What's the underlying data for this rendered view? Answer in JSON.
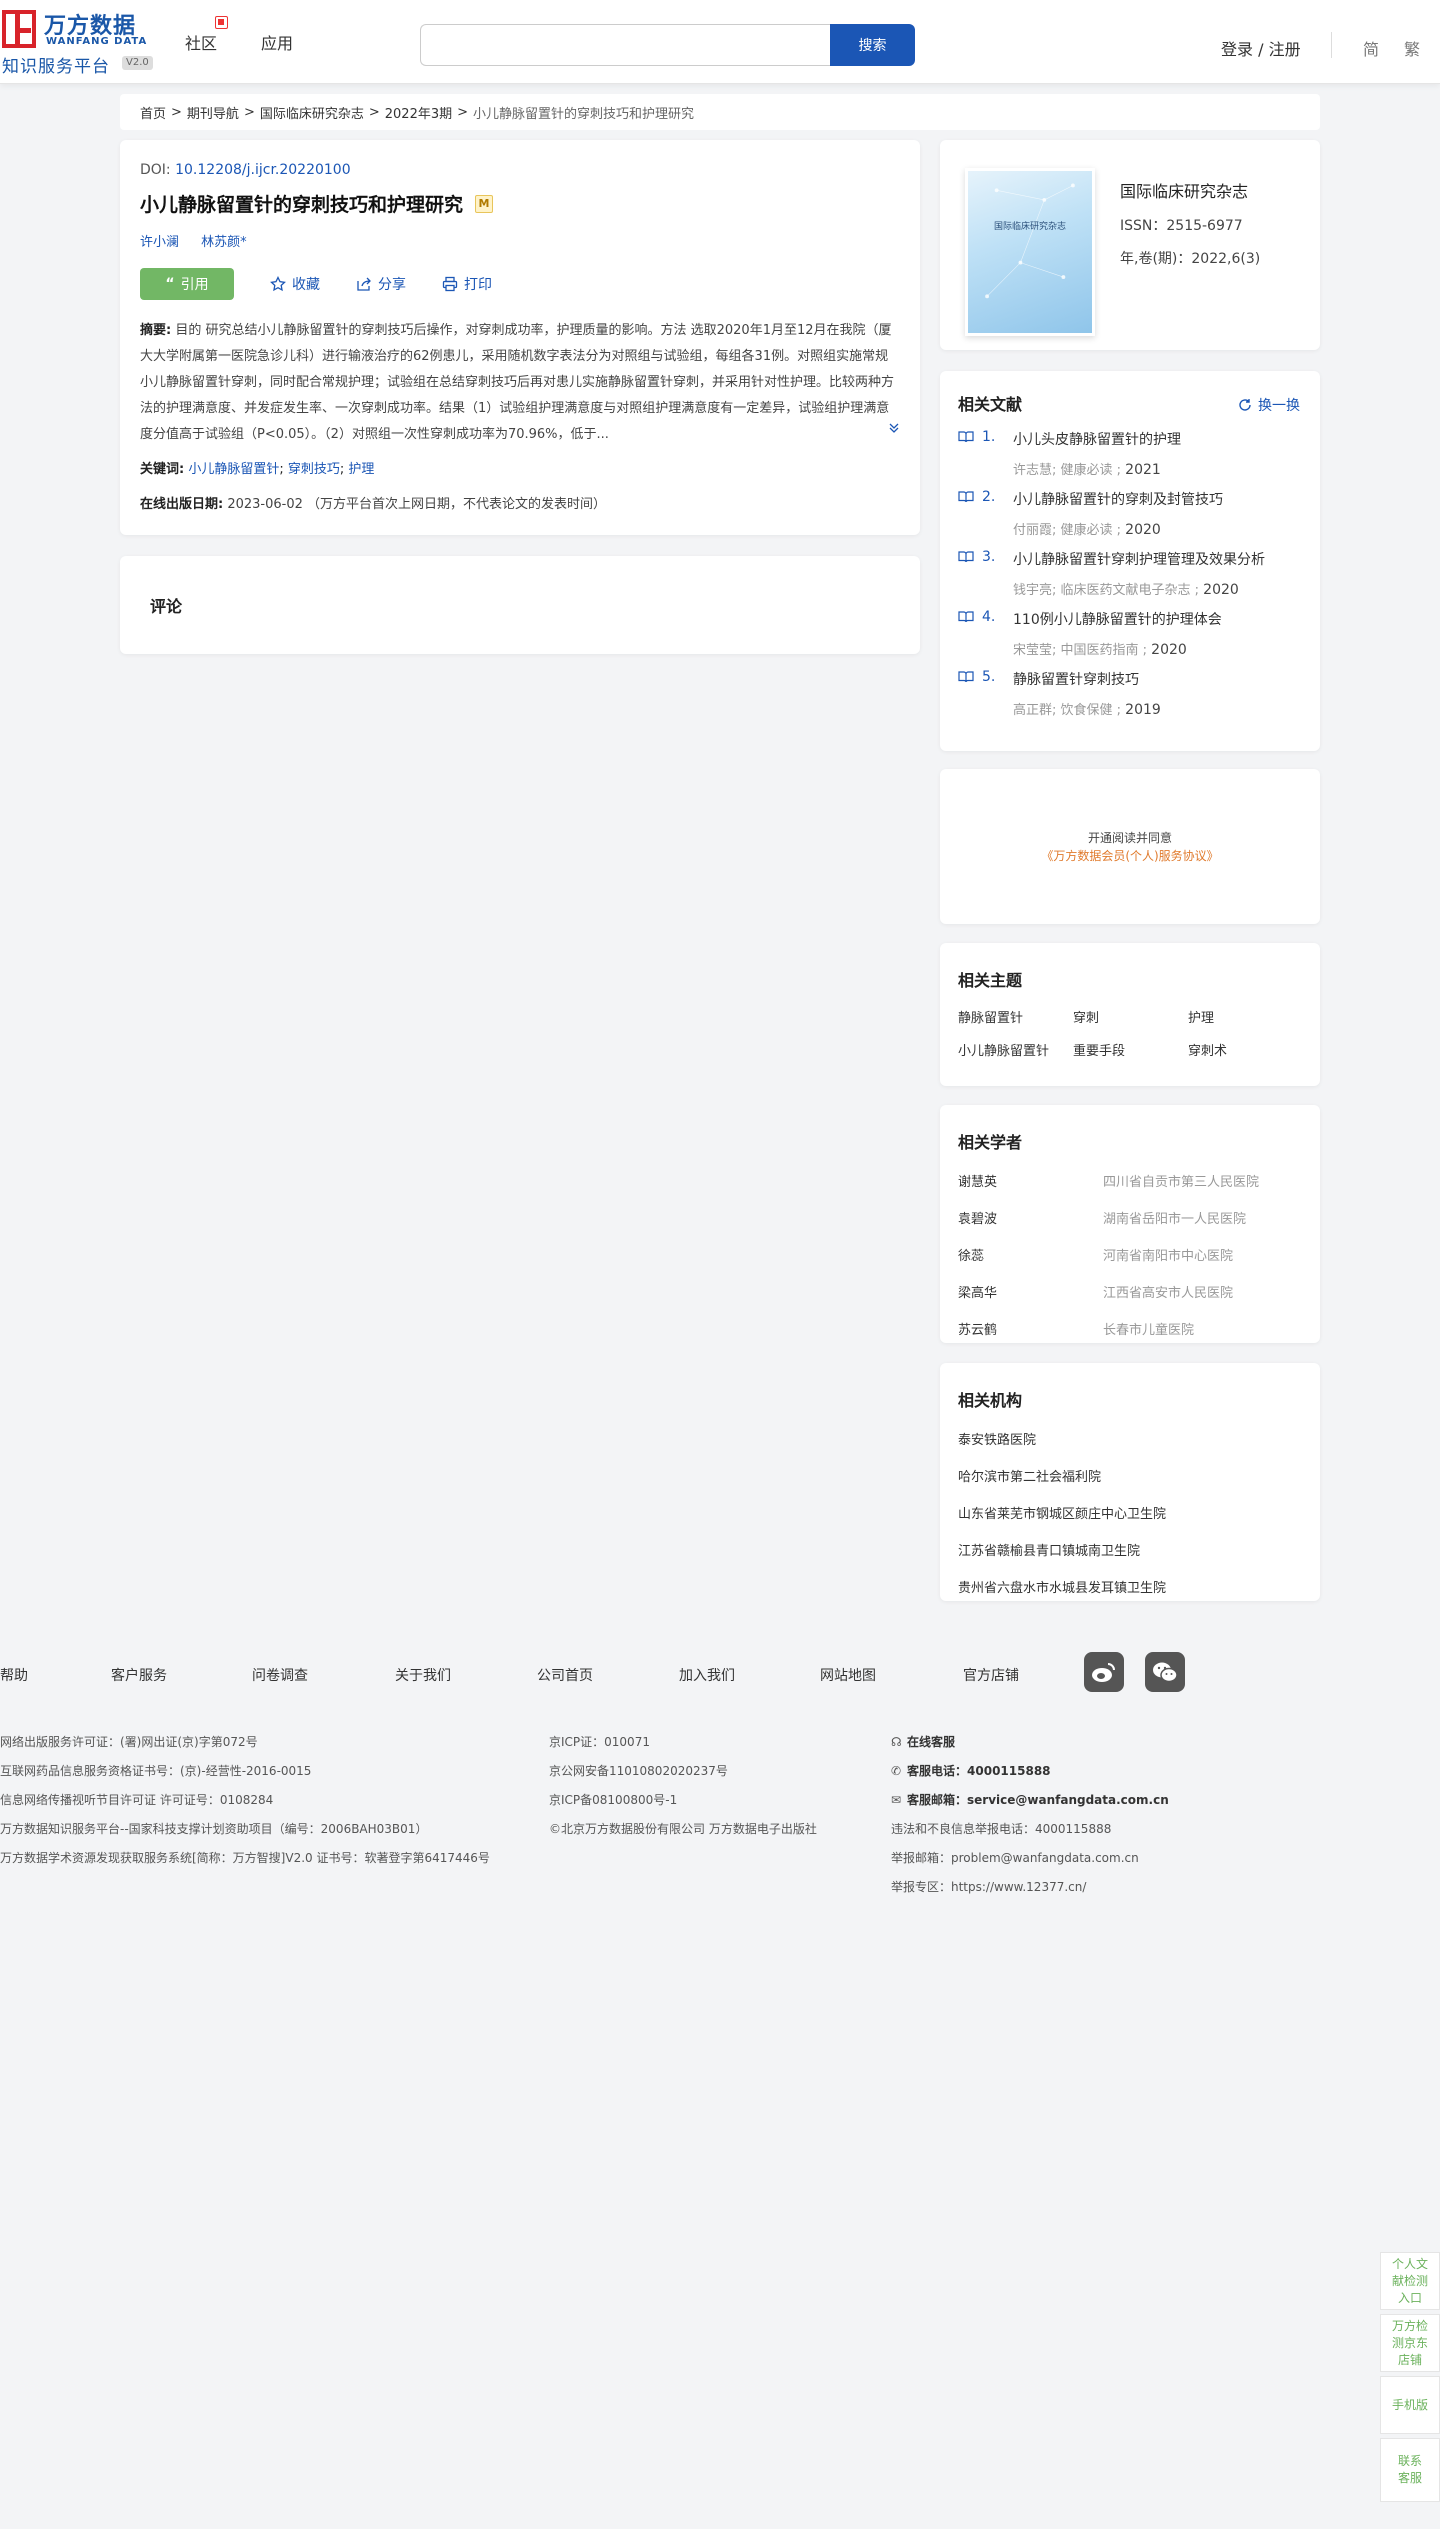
{
  "header": {
    "logo_cn": "万方数据",
    "logo_en": "WANFANG DATA",
    "logo_sub": "知识服务平台",
    "logo_version": "V2.0",
    "nav": [
      "社区",
      "应用"
    ],
    "search_placeholder": "",
    "search_button": "搜索",
    "login": "登录 / 注册",
    "lang_simplified": "简",
    "lang_traditional": "繁"
  },
  "breadcrumb": [
    "首页",
    "期刊导航",
    "国际临床研究杂志",
    "2022年3期",
    "小儿静脉留置针的穿刺技巧和护理研究"
  ],
  "article": {
    "doi_label": "DOI: ",
    "doi": "10.12208/j.ijcr.20220100",
    "title": "小儿静脉留置针的穿刺技巧和护理研究",
    "badge": "M",
    "authors": [
      "许小澜",
      "林苏颜*"
    ],
    "actions": {
      "cite": "引用",
      "favorite": "收藏",
      "share": "分享",
      "print": "打印"
    },
    "abstract_label": "摘要:",
    "abstract": "目的 研究总结小儿静脉留置针的穿刺技巧后操作，对穿刺成功率，护理质量的影响。方法 选取2020年1月至12月在我院（厦大大学附属第一医院急诊儿科）进行输液治疗的62例患儿，采用随机数字表法分为对照组与试验组，每组各31例。对照组实施常规小儿静脉留置针穿刺，同时配合常规护理；试验组在总结穿刺技巧后再对患儿实施静脉留置针穿刺，并采用针对性护理。比较两种方法的护理满意度、并发症发生率、一次穿刺成功率。结果（1）试验组护理满意度与对照组护理满意度有一定差异，试验组护理满意度分值高于试验组（P<0.05）。（2）对照组一次性穿刺成功率为70.96%，低于...",
    "keywords_label": "关键词:",
    "keywords": [
      "小儿静脉留置针",
      "穿刺技巧",
      "护理"
    ],
    "pubdate_label": "在线出版日期:",
    "pubdate": "2023-06-02",
    "pubdate_note": "（万方平台首次上网日期，不代表论文的发表时间）"
  },
  "comment": {
    "title": "评论"
  },
  "journal": {
    "cover_title": "国际临床研究杂志",
    "name": "国际临床研究杂志",
    "issn": "ISSN：2515-6977",
    "volume": "年,卷(期)：2022,6(3)"
  },
  "related": {
    "title": "相关文献",
    "swap": "换一换",
    "items": [
      {
        "num": "1.",
        "title": "小儿头皮静脉留置针的护理",
        "meta": "许志慧; 健康必读 ; ",
        "year": "2021"
      },
      {
        "num": "2.",
        "title": "小儿静脉留置针的穿刺及封管技巧",
        "meta": "付丽霞; 健康必读 ; ",
        "year": "2020"
      },
      {
        "num": "3.",
        "title": "小儿静脉留置针穿刺护理管理及效果分析",
        "meta": "钱宇亮; 临床医药文献电子杂志 ; ",
        "year": "2020"
      },
      {
        "num": "4.",
        "title": "110例小儿静脉留置针的护理体会",
        "meta": "宋莹莹; 中国医药指南 ; ",
        "year": "2020"
      },
      {
        "num": "5.",
        "title": "静脉留置针穿刺技巧",
        "meta": "高正群; 饮食保健 ; ",
        "year": "2019"
      }
    ]
  },
  "open_read": {
    "line1": "开通阅读并同意",
    "line2": "《万方数据会员(个人)服务协议》"
  },
  "topics": {
    "title": "相关主题",
    "items": [
      "静脉留置针",
      "穿刺",
      "护理",
      "小儿静脉留置针",
      "重要手段",
      "穿刺术"
    ]
  },
  "scholars": {
    "title": "相关学者",
    "items": [
      {
        "name": "谢慧英",
        "org": "四川省自贡市第三人民医院"
      },
      {
        "name": "袁碧波",
        "org": "湖南省岳阳市一人民医院"
      },
      {
        "name": "徐蕊",
        "org": "河南省南阳市中心医院"
      },
      {
        "name": "梁高华",
        "org": "江西省高安市人民医院"
      },
      {
        "name": "苏云鹤",
        "org": "长春市儿童医院"
      }
    ]
  },
  "orgs": {
    "title": "相关机构",
    "items": [
      "泰安铁路医院",
      "哈尔滨市第二社会福利院",
      "山东省莱芜市钢城区颜庄中心卫生院",
      "江苏省赣榆县青口镇城南卫生院",
      "贵州省六盘水市水城县发耳镇卫生院"
    ]
  },
  "footer": {
    "links": [
      "帮助",
      "客户服务",
      "问卷调查",
      "关于我们",
      "公司首页",
      "加入我们",
      "网站地图",
      "官方店铺"
    ],
    "col1": [
      "网络出版服务许可证：(署)网出证(京)字第072号",
      "互联网药品信息服务资格证书号：(京)-经营性-2016-0015",
      "信息网络传播视听节目许可证 许可证号：0108284",
      "万方数据知识服务平台--国家科技支撑计划资助项目（编号：2006BAH03B01）",
      "万方数据学术资源发现获取服务系统[简称：万方智搜]V2.0 证书号：软著登字第6417446号"
    ],
    "col2": [
      "京ICP证：010071",
      "京公网安备11010802020237号",
      "京ICP备08100800号-1",
      "©北京万方数据股份有限公司 万方数据电子出版社"
    ],
    "col3": {
      "online": "在线客服",
      "phone_label": "客服电话：",
      "phone": "4000115888",
      "email_label": "客服邮箱：",
      "email": "service@wanfangdata.com.cn",
      "report_phone": "违法和不良信息举报电话：4000115888",
      "report_email": "举报邮箱：problem@wanfangdata.com.cn",
      "report_site": "举报专区：https://www.12377.cn/"
    }
  },
  "float": [
    "个人文献检测入口",
    "万方检测京东店铺",
    "手机版",
    "联系客服"
  ]
}
